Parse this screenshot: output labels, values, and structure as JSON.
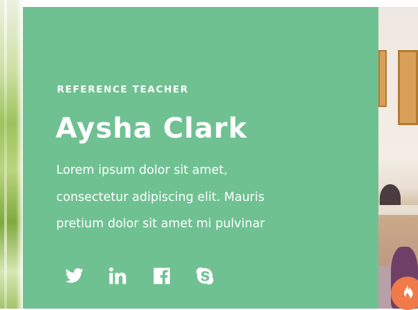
{
  "profile": {
    "eyebrow": "REFERENCE TEACHER",
    "name": "Aysha Clark",
    "bio_lines": [
      "Lorem ipsum dolor sit amet,",
      "consectetur adipiscing elit. Mauris",
      "pretium dolor sit amet mi pulvinar"
    ]
  },
  "social": [
    "twitter-icon",
    "linkedin-icon",
    "facebook-icon",
    "skype-icon"
  ],
  "colors": {
    "card": "#6fc192",
    "text": "#ffffff",
    "fab": "#f07a4a"
  }
}
